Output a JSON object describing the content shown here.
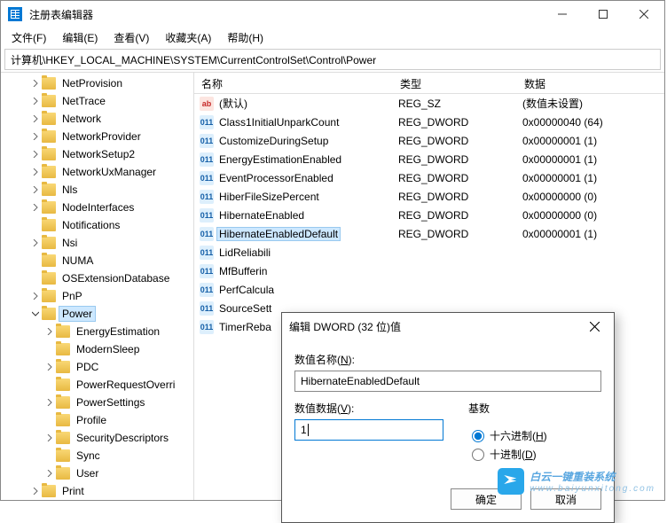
{
  "window": {
    "title": "注册表编辑器",
    "controls": {
      "min": "—",
      "max": "☐",
      "close": "✕"
    }
  },
  "menu": {
    "file": "文件(F)",
    "edit": "编辑(E)",
    "view": "查看(V)",
    "favorites": "收藏夹(A)",
    "help": "帮助(H)"
  },
  "addressbar": "计算机\\HKEY_LOCAL_MACHINE\\SYSTEM\\CurrentControlSet\\Control\\Power",
  "tree": [
    {
      "indent": 2,
      "chev": ">",
      "label": "NetProvision"
    },
    {
      "indent": 2,
      "chev": ">",
      "label": "NetTrace"
    },
    {
      "indent": 2,
      "chev": ">",
      "label": "Network"
    },
    {
      "indent": 2,
      "chev": ">",
      "label": "NetworkProvider"
    },
    {
      "indent": 2,
      "chev": ">",
      "label": "NetworkSetup2"
    },
    {
      "indent": 2,
      "chev": ">",
      "label": "NetworkUxManager"
    },
    {
      "indent": 2,
      "chev": ">",
      "label": "Nls"
    },
    {
      "indent": 2,
      "chev": ">",
      "label": "NodeInterfaces"
    },
    {
      "indent": 2,
      "chev": "",
      "label": "Notifications"
    },
    {
      "indent": 2,
      "chev": ">",
      "label": "Nsi"
    },
    {
      "indent": 2,
      "chev": "",
      "label": "NUMA"
    },
    {
      "indent": 2,
      "chev": "",
      "label": "OSExtensionDatabase"
    },
    {
      "indent": 2,
      "chev": ">",
      "label": "PnP"
    },
    {
      "indent": 2,
      "chev": "v",
      "label": "Power",
      "selected": true
    },
    {
      "indent": 3,
      "chev": ">",
      "label": "EnergyEstimation"
    },
    {
      "indent": 3,
      "chev": "",
      "label": "ModernSleep"
    },
    {
      "indent": 3,
      "chev": ">",
      "label": "PDC"
    },
    {
      "indent": 3,
      "chev": "",
      "label": "PowerRequestOverri"
    },
    {
      "indent": 3,
      "chev": ">",
      "label": "PowerSettings"
    },
    {
      "indent": 3,
      "chev": "",
      "label": "Profile"
    },
    {
      "indent": 3,
      "chev": ">",
      "label": "SecurityDescriptors"
    },
    {
      "indent": 3,
      "chev": "",
      "label": "Sync"
    },
    {
      "indent": 3,
      "chev": ">",
      "label": "User"
    },
    {
      "indent": 2,
      "chev": ">",
      "label": "Print"
    }
  ],
  "columns": {
    "name": "名称",
    "type": "类型",
    "data": "数据"
  },
  "values": [
    {
      "icon": "sz",
      "iconText": "ab",
      "name": "(默认)",
      "type": "REG_SZ",
      "data": "(数值未设置)"
    },
    {
      "icon": "dw",
      "iconText": "011",
      "name": "Class1InitialUnparkCount",
      "type": "REG_DWORD",
      "data": "0x00000040 (64)"
    },
    {
      "icon": "dw",
      "iconText": "011",
      "name": "CustomizeDuringSetup",
      "type": "REG_DWORD",
      "data": "0x00000001 (1)"
    },
    {
      "icon": "dw",
      "iconText": "011",
      "name": "EnergyEstimationEnabled",
      "type": "REG_DWORD",
      "data": "0x00000001 (1)"
    },
    {
      "icon": "dw",
      "iconText": "011",
      "name": "EventProcessorEnabled",
      "type": "REG_DWORD",
      "data": "0x00000001 (1)"
    },
    {
      "icon": "dw",
      "iconText": "011",
      "name": "HiberFileSizePercent",
      "type": "REG_DWORD",
      "data": "0x00000000 (0)"
    },
    {
      "icon": "dw",
      "iconText": "011",
      "name": "HibernateEnabled",
      "type": "REG_DWORD",
      "data": "0x00000000 (0)"
    },
    {
      "icon": "dw",
      "iconText": "011",
      "name": "HibernateEnabledDefault",
      "type": "REG_DWORD",
      "data": "0x00000001 (1)",
      "selected": true
    },
    {
      "icon": "dw",
      "iconText": "011",
      "name": "LidReliabili",
      "type": "",
      "data": ""
    },
    {
      "icon": "dw",
      "iconText": "011",
      "name": "MfBufferin",
      "type": "",
      "data": ""
    },
    {
      "icon": "dw",
      "iconText": "011",
      "name": "PerfCalcula",
      "type": "",
      "data": ""
    },
    {
      "icon": "dw",
      "iconText": "011",
      "name": "SourceSett",
      "type": "",
      "data": ""
    },
    {
      "icon": "dw",
      "iconText": "011",
      "name": "TimerReba",
      "type": "",
      "data": ""
    }
  ],
  "dialog": {
    "title": "编辑 DWORD (32 位)值",
    "nameLabelPre": "数值名称(",
    "nameLabelKey": "N",
    "nameLabelPost": "):",
    "nameValue": "HibernateEnabledDefault",
    "dataLabelPre": "数值数据(",
    "dataLabelKey": "V",
    "dataLabelPost": "):",
    "dataValue": "1",
    "baseLabel": "基数",
    "hexPre": "十六进制(",
    "hexKey": "H",
    "hexPost": ")",
    "decPre": "十进制(",
    "decKey": "D",
    "decPost": ")",
    "ok": "确定",
    "cancel": "取消"
  },
  "watermark": {
    "main": "白云一键重装系统",
    "sub": "www.baiyunxitong.com"
  }
}
